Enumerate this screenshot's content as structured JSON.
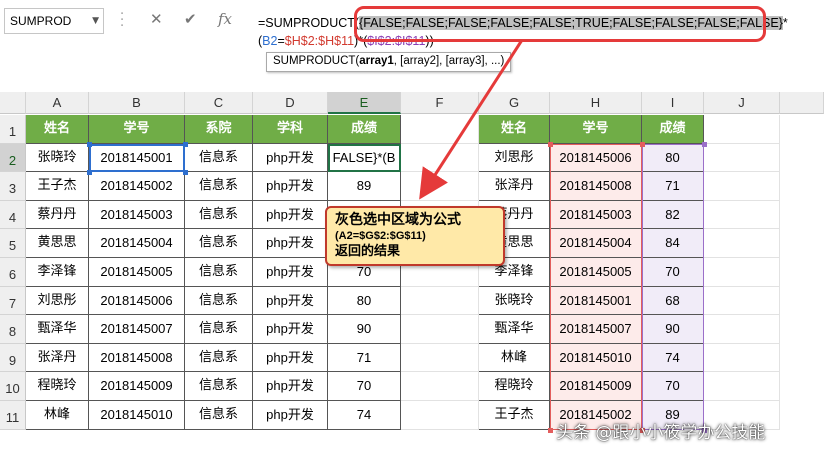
{
  "namebox": {
    "value": "SUMPROD"
  },
  "formula_bar": {
    "fx_label": "fx",
    "parts": [
      {
        "text": "=SUMPRODUCT(",
        "style": "plain"
      },
      {
        "text": "{FALSE;FALSE;FALSE;FALSE;FALSE;TRUE;FALSE;FALSE;FALSE;FALSE}",
        "style": "hl"
      },
      {
        "text": "*(",
        "style": "plain"
      },
      {
        "text": "B2",
        "style": "blue"
      },
      {
        "text": "=",
        "style": "plain"
      },
      {
        "text": "$H$2:$H$11",
        "style": "red"
      },
      {
        "text": ")*(",
        "style": "plain"
      },
      {
        "text": "$I$2:$I$11",
        "style": "purple"
      },
      {
        "text": "))",
        "style": "plain"
      }
    ],
    "tooltip": {
      "prefix": "SUMPRODUCT(",
      "bold_arg": "array1",
      "rest": ", [array2], [array3], ...)"
    }
  },
  "columns": [
    "A",
    "B",
    "C",
    "D",
    "E",
    "F",
    "G",
    "H",
    "I",
    "J"
  ],
  "rows": [
    "1",
    "2",
    "3",
    "4",
    "5",
    "6",
    "7",
    "8",
    "9",
    "10",
    "11"
  ],
  "left_table": {
    "headers": [
      "姓名",
      "学号",
      "系院",
      "学科",
      "成绩"
    ],
    "rows": [
      [
        "张晓玲",
        "2018145001",
        "信息系",
        "php开发",
        "FALSE}*(B"
      ],
      [
        "王子杰",
        "2018145002",
        "信息系",
        "php开发",
        "89"
      ],
      [
        "蔡丹丹",
        "2018145003",
        "信息系",
        "php开发",
        ""
      ],
      [
        "黄思思",
        "2018145004",
        "信息系",
        "php开发",
        ""
      ],
      [
        "李泽锋",
        "2018145005",
        "信息系",
        "php开发",
        "70"
      ],
      [
        "刘思彤",
        "2018145006",
        "信息系",
        "php开发",
        "80"
      ],
      [
        "甄泽华",
        "2018145007",
        "信息系",
        "php开发",
        "90"
      ],
      [
        "张泽丹",
        "2018145008",
        "信息系",
        "php开发",
        "71"
      ],
      [
        "程晓玲",
        "2018145009",
        "信息系",
        "php开发",
        "70"
      ],
      [
        "林峰",
        "2018145010",
        "信息系",
        "php开发",
        "74"
      ]
    ]
  },
  "right_table": {
    "headers": [
      "姓名",
      "学号",
      "成绩"
    ],
    "rows": [
      [
        "刘思彤",
        "2018145006",
        "80"
      ],
      [
        "张泽丹",
        "2018145008",
        "71"
      ],
      [
        "蔡丹丹",
        "2018145003",
        "82"
      ],
      [
        "黄思思",
        "2018145004",
        "84"
      ],
      [
        "李泽锋",
        "2018145005",
        "70"
      ],
      [
        "张晓玲",
        "2018145001",
        "68"
      ],
      [
        "甄泽华",
        "2018145007",
        "90"
      ],
      [
        "林峰",
        "2018145010",
        "74"
      ],
      [
        "程晓玲",
        "2018145009",
        "70"
      ],
      [
        "王子杰",
        "2018145002",
        "89"
      ]
    ]
  },
  "callout": {
    "line1": "灰色选中区域为公式",
    "line2": "(A2=$G$2:$G$11)",
    "line3": "返回的结果"
  },
  "watermark": "头条 @跟小小筱学办公技能",
  "colors": {
    "header_green": "#70ad47",
    "highlight_red": "#e53a3a",
    "ref_blue": "#2e6fcf",
    "ref_red": "#d23a2f",
    "ref_purple": "#8a3fb4",
    "callout_fill": "#ffe9a8"
  },
  "icons": [
    "chevron-down-icon",
    "cancel-x-icon",
    "confirm-check-icon",
    "insert-function-icon"
  ]
}
